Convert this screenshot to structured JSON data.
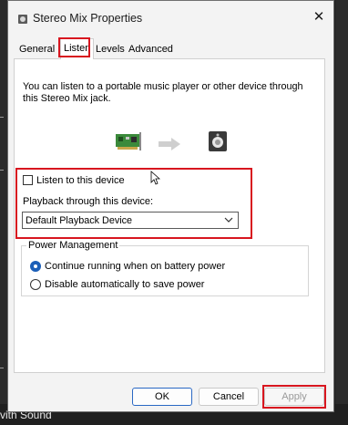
{
  "window": {
    "title": "Stereo Mix Properties",
    "close_glyph": "✕"
  },
  "tabs": [
    {
      "label": "General",
      "active": false
    },
    {
      "label": "Listen",
      "active": true
    },
    {
      "label": "Levels",
      "active": false
    },
    {
      "label": "Advanced",
      "active": false
    }
  ],
  "listen": {
    "description": "You can listen to a portable music player or other device through this Stereo Mix jack.",
    "source_icon": "sound-card-icon",
    "arrow_icon": "arrow-right-icon",
    "target_icon": "speaker-icon",
    "listen_checkbox_label": "Listen to this device",
    "listen_checked": false,
    "playback_label": "Playback through this device:",
    "playback_selected": "Default Playback Device"
  },
  "power": {
    "group_label": "Power Management",
    "options": [
      {
        "label": "Continue running when on battery power",
        "selected": true
      },
      {
        "label": "Disable automatically to save power",
        "selected": false
      }
    ]
  },
  "buttons": {
    "ok": "OK",
    "cancel": "Cancel",
    "apply": "Apply"
  },
  "background": {
    "partial_text": "vith Sound"
  },
  "colors": {
    "highlight": "#d8161f",
    "accent": "#1c5fb8"
  }
}
